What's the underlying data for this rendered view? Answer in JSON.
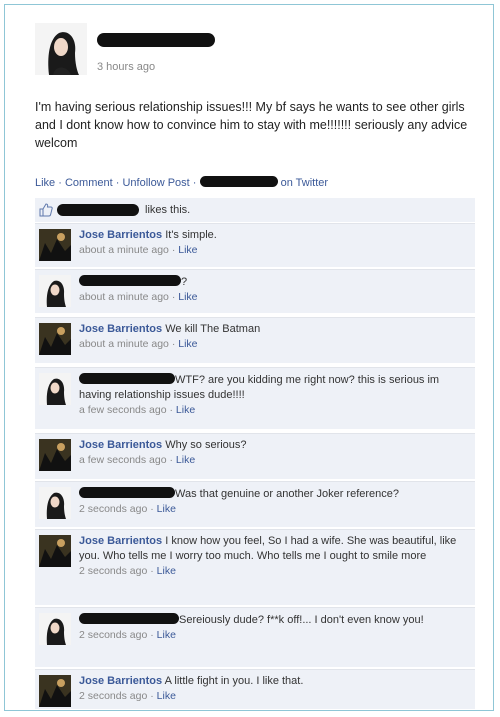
{
  "post": {
    "time": "3 hours ago",
    "text": "I'm having serious relationship issues!!! My bf says he wants to see other girls and I dont know how to convince him to stay with me!!!!!!! seriously any advice welcom",
    "actions": {
      "like": "Like",
      "comment": "Comment",
      "unfollow": "Unfollow Post",
      "sep": "·",
      "on_twitter": "on Twitter"
    },
    "likes_suffix": "likes this."
  },
  "comments": [
    {
      "name": "Jose Barrientos",
      "text": "It's simple.",
      "time": "about a minute ago",
      "like": "Like"
    },
    {
      "name": "",
      "text": "?",
      "time": "about a minute ago",
      "like": "Like"
    },
    {
      "name": "Jose Barrientos",
      "text": "We kill The Batman",
      "time": "about a minute ago",
      "like": "Like"
    },
    {
      "name": "",
      "text": "WTF? are you kidding me right now? this is serious im having relationship issues dude!!!!",
      "time": "a few seconds ago",
      "like": "Like"
    },
    {
      "name": "Jose Barrientos",
      "text": "Why so serious?",
      "time": "a few seconds ago",
      "like": "Like"
    },
    {
      "name": "",
      "text": "Was that genuine or another Joker reference?",
      "time": "2 seconds ago",
      "like": "Like"
    },
    {
      "name": "Jose Barrientos",
      "text": "I know how you feel, So I had a wife. She was beautiful, like you. Who tells me I worry too much. Who tells me I ought to smile more",
      "time": "2 seconds ago",
      "like": "Like"
    },
    {
      "name": "",
      "text": "Sereiously dude? f**k off!... I don't even know you!",
      "time": "2 seconds ago",
      "like": "Like"
    },
    {
      "name": "Jose Barrientos",
      "text": "A little fight in you. I like that.",
      "time": "2 seconds ago",
      "like": "Like"
    }
  ],
  "colors": {
    "link": "#3b5998",
    "comment_bg": "#eef1f7",
    "frame": "#8fc6d6"
  }
}
